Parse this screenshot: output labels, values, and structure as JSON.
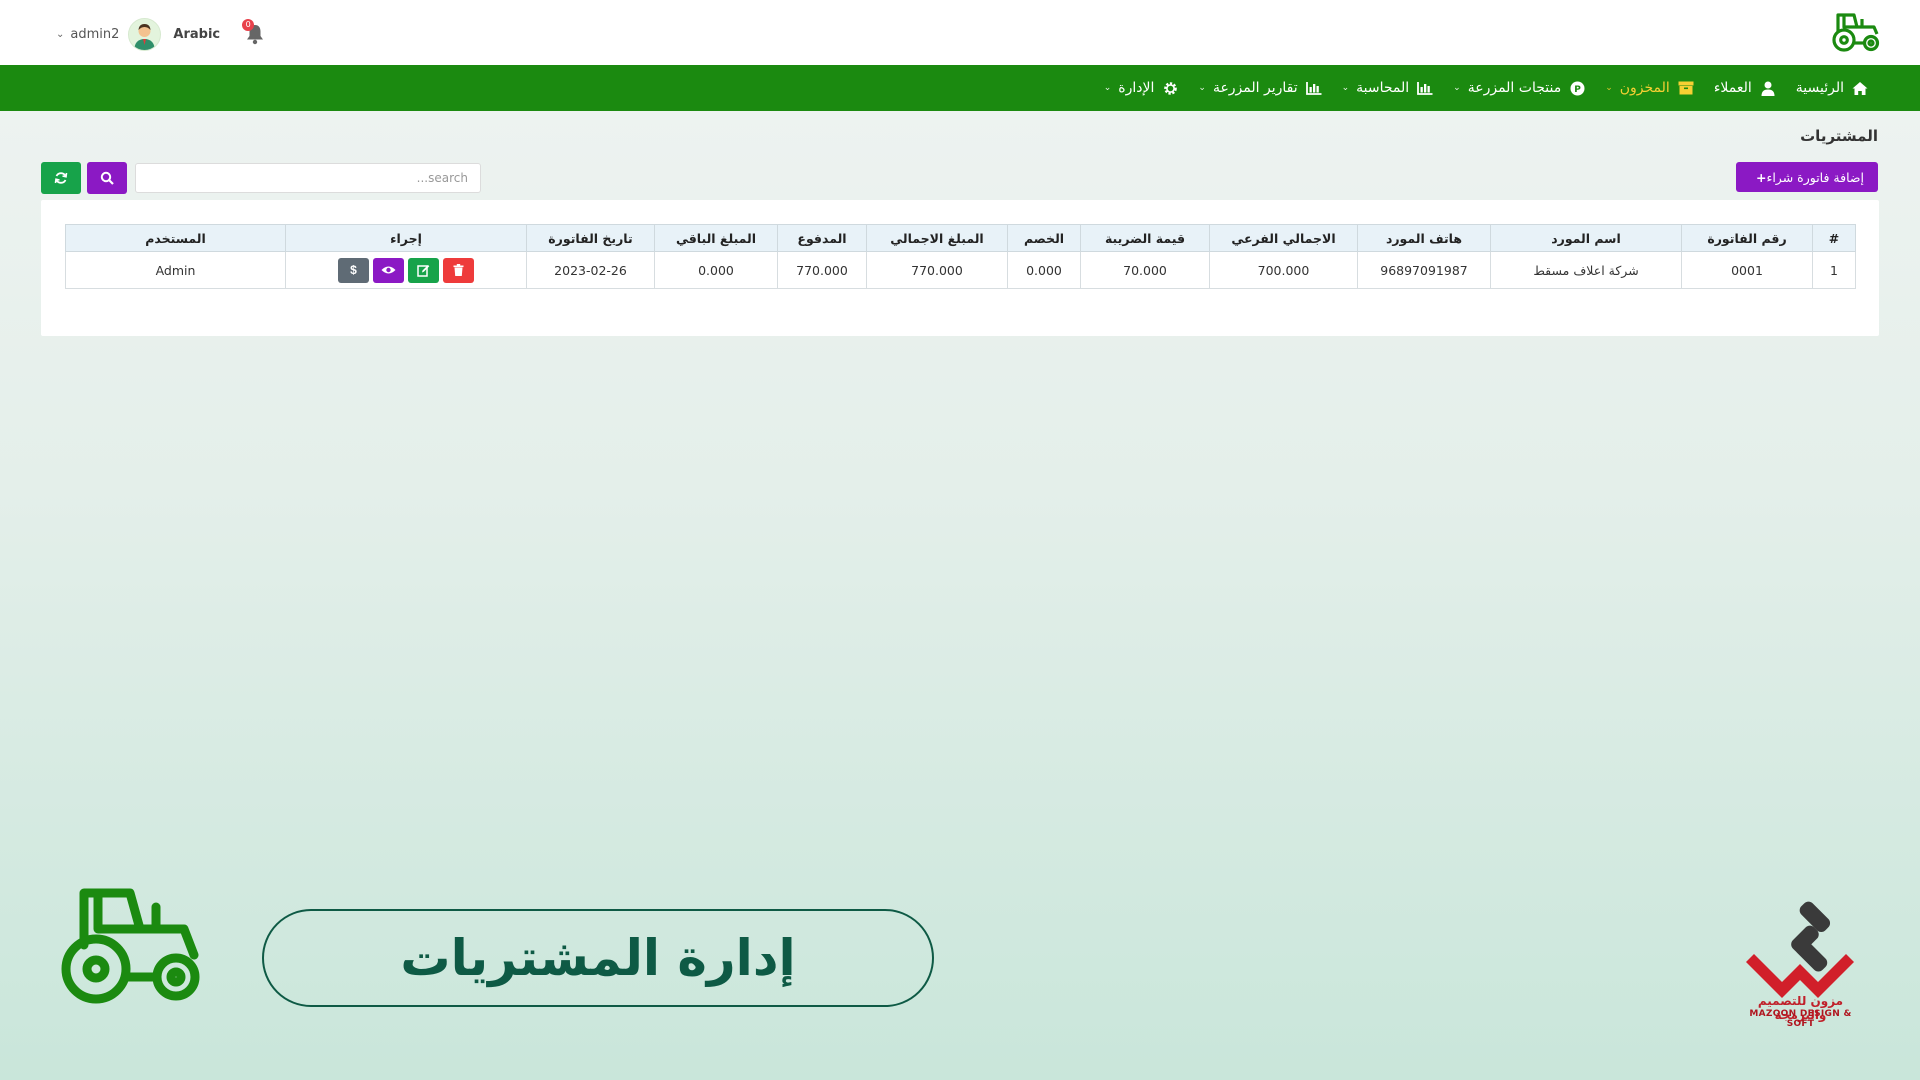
{
  "header": {
    "user_name": "admin2",
    "language": "Arabic",
    "notification_count": "0"
  },
  "nav": {
    "items": [
      {
        "label": "الرئيسية",
        "icon": "home-icon",
        "dropdown": false,
        "active": false
      },
      {
        "label": "العملاء",
        "icon": "user-icon",
        "dropdown": false,
        "active": false
      },
      {
        "label": "المخزون",
        "icon": "box-icon",
        "dropdown": true,
        "active": true
      },
      {
        "label": "منتجات المزرعة",
        "icon": "product-icon",
        "dropdown": true,
        "active": false
      },
      {
        "label": "المحاسبة",
        "icon": "chart-icon",
        "dropdown": true,
        "active": false
      },
      {
        "label": "تقارير المزرعة",
        "icon": "chart-icon",
        "dropdown": true,
        "active": false
      },
      {
        "label": "الإدارة",
        "icon": "gear-icon",
        "dropdown": true,
        "active": false
      }
    ]
  },
  "page": {
    "title": "المشتريات",
    "add_button": "إضافة فاتورة شراء",
    "search_placeholder": "search..."
  },
  "table": {
    "headers": [
      "#",
      "رقم الفاتورة",
      "اسم المورد",
      "هاتف المورد",
      "الاجمالي الفرعي",
      "قيمة الضريبة",
      "الخصم",
      "المبلغ الاجمالي",
      "المدفوع",
      "المبلغ الباقي",
      "تاريخ الفاتورة",
      "إجراء",
      "المستخدم"
    ],
    "rows": [
      {
        "index": "1",
        "invoice_no": "0001",
        "supplier_name": "شركة اعلاف مسقط",
        "supplier_phone": "96897091987",
        "subtotal": "700.000",
        "tax": "70.000",
        "discount": "0.000",
        "total": "770.000",
        "paid": "770.000",
        "remaining": "0.000",
        "date": "2023-02-26",
        "user": "Admin"
      }
    ]
  },
  "promo": {
    "title": "إدارة المشتريات"
  },
  "logo": {
    "caption_ar": "مزون للتصميم والبرمجة",
    "caption_en": "MAZOON DESIGN & SOFT"
  },
  "colors": {
    "nav_green": "#1b8a10",
    "active_yellow": "#f6d033",
    "purple": "#8b19c4",
    "green_button": "#17a34a",
    "danger": "#ee3b3b",
    "promo_teal": "#0e5a45"
  }
}
